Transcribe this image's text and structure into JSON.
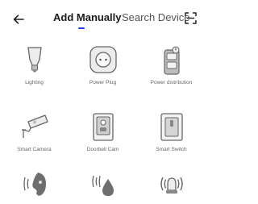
{
  "header": {
    "back_icon": "arrow-left-icon",
    "tabs": [
      {
        "label": "Add Manually",
        "active": true
      },
      {
        "label": "Search Device",
        "active": false
      }
    ],
    "scan_icon": "scan-frame-icon",
    "active_tab_color": "#1f3cf0"
  },
  "devices": [
    {
      "label": "Lighting",
      "icon": "light-bulb-icon"
    },
    {
      "label": "Power Plug",
      "icon": "power-plug-icon"
    },
    {
      "label": "Power distribution",
      "icon": "power-strip-icon"
    },
    {
      "label": "Smart Camera",
      "icon": "smart-camera-icon"
    },
    {
      "label": "Doorbell Cam",
      "icon": "doorbell-cam-icon"
    },
    {
      "label": "Smart Switch",
      "icon": "smart-switch-icon"
    },
    {
      "label": "",
      "icon": "sound-sensor-icon"
    },
    {
      "label": "",
      "icon": "water-leak-sensor-icon"
    },
    {
      "label": "",
      "icon": "alarm-siren-icon"
    }
  ],
  "colors": {
    "icon_stroke": "#555555",
    "icon_fill": "#d8d8d8",
    "icon_dark": "#6e6e6e"
  }
}
